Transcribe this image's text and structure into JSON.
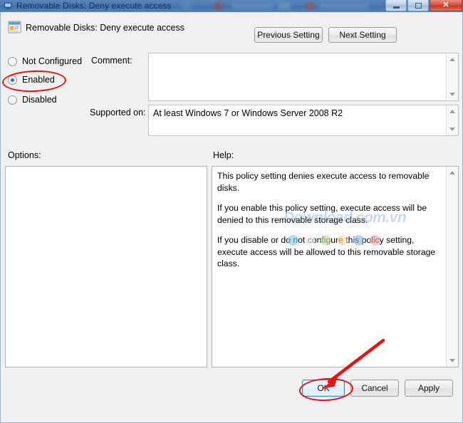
{
  "window": {
    "title": "Removable Disks: Deny execute access",
    "title_icon": "policy-window-icon",
    "controls": {
      "minimize": "minimize-icon",
      "maximize": "maximize-icon",
      "close": "close-icon",
      "close_glyph": "✕"
    }
  },
  "header": {
    "icon": "group-policy-setting-icon",
    "setting_name": "Removable Disks: Deny execute access",
    "previous_setting_label": "Previous Setting",
    "next_setting_label": "Next Setting"
  },
  "state_options": {
    "items": [
      {
        "label": "Not Configured",
        "selected": false
      },
      {
        "label": "Enabled",
        "selected": true
      },
      {
        "label": "Disabled",
        "selected": false
      }
    ],
    "selected_value": "Enabled"
  },
  "comment": {
    "label": "Comment:",
    "value": "",
    "placeholder": ""
  },
  "supported_on": {
    "label": "Supported on:",
    "value": "At least Windows 7 or Windows Server 2008 R2"
  },
  "options_panel": {
    "label": "Options:",
    "content": ""
  },
  "help_panel": {
    "label": "Help:",
    "paragraphs": [
      "This policy setting denies execute access to removable disks.",
      "If you enable this policy setting, execute access will be denied to this removable storage class.",
      "If you disable or do not configure this policy setting, execute access will be allowed to this removable storage class."
    ]
  },
  "watermark": {
    "text": "Download.com.vn",
    "dot_colors": [
      "#7ec8e8",
      "#ececec",
      "#c6e3a8",
      "#f6d9a0",
      "#8fb8dd",
      "#f2a9a9"
    ]
  },
  "footer": {
    "ok_label": "OK",
    "cancel_label": "Cancel",
    "apply_label": "Apply"
  },
  "annotations": {
    "accent_color": "#e81212",
    "highlight_enabled": "Enabled",
    "highlight_ok": "OK"
  }
}
